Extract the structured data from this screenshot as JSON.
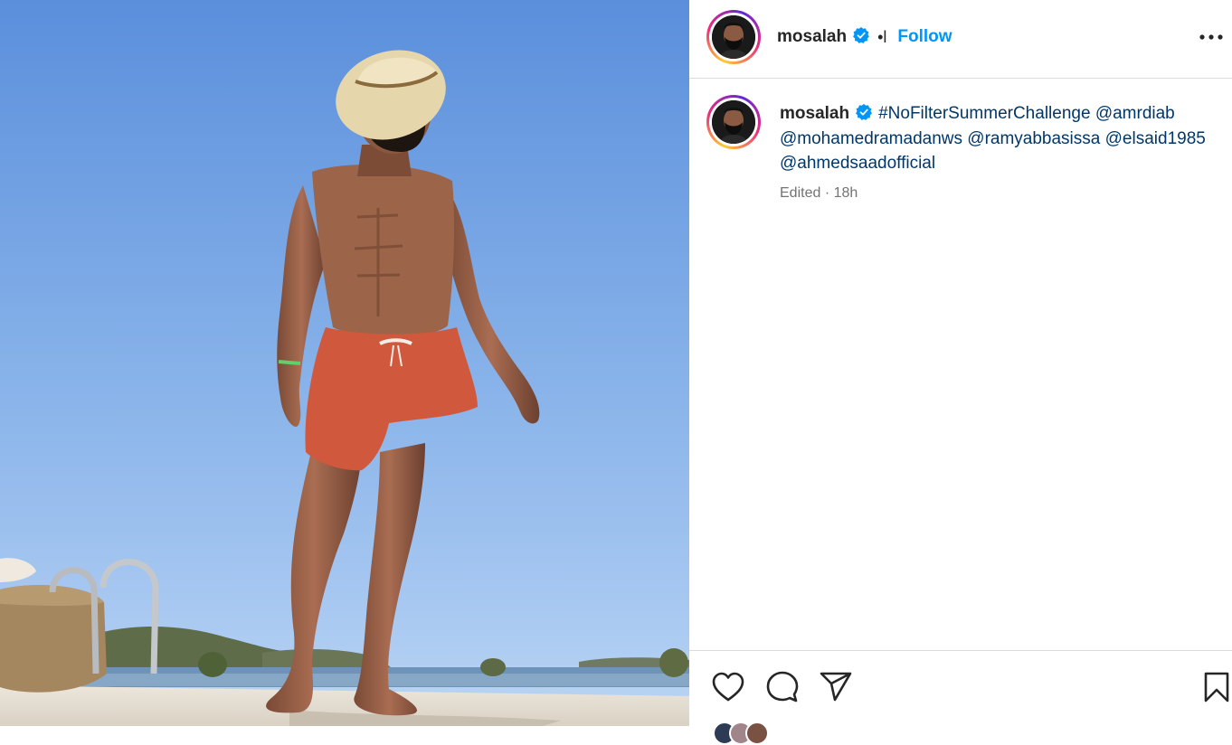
{
  "post": {
    "author": {
      "username": "mosalah",
      "verified": true
    },
    "header": {
      "separator": "•l",
      "follow_label": "Follow"
    },
    "caption": {
      "username": "mosalah",
      "parts": [
        "#NoFilterSummerChallenge",
        "@amrdiab",
        "@mohamedramadanws",
        "@ramyabbasissa",
        "@elsaid1985",
        "@ahmedsaadofficial"
      ]
    },
    "meta": "Edited · 18h"
  },
  "icons": {
    "more": "more-horizontal-icon",
    "verified": "verified-badge-icon",
    "like": "heart-icon",
    "comment": "comment-bubble-icon",
    "share": "paper-plane-icon",
    "save": "bookmark-icon"
  },
  "colors": {
    "accent": "#0095f6",
    "verified": "#0095f6",
    "tag": "#00376b",
    "muted": "#737373",
    "divider": "#dbdbdb"
  }
}
